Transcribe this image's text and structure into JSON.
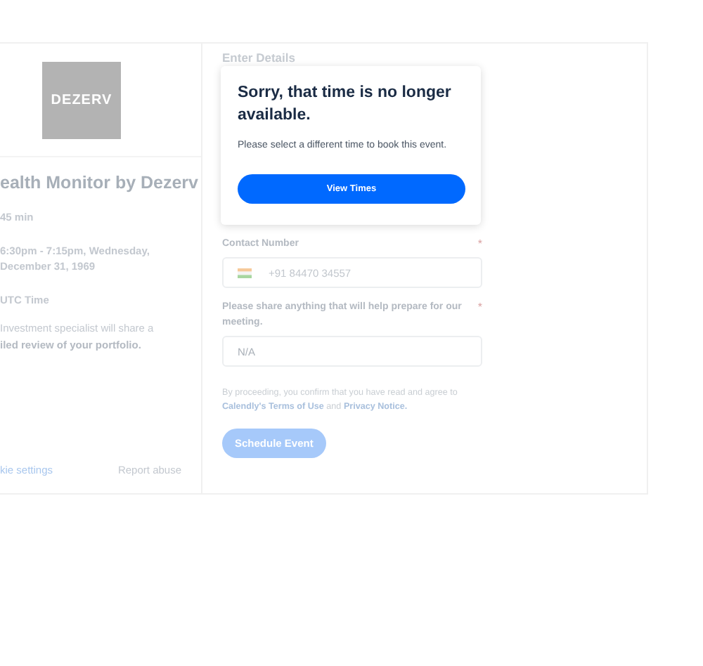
{
  "event": {
    "logo": "DEZERV",
    "title": "ealth Monitor by Dezerv",
    "details": [
      {
        "kind": "plain",
        "text": "45 min"
      },
      {
        "kind": "plain",
        "text": "6:30pm - 7:15pm, Wednesday, December 31, 1969"
      },
      {
        "kind": "plain",
        "text": "UTC Time"
      },
      {
        "kind": "rich",
        "text": "Investment specialist will share a **iled review of your portfolio.**"
      }
    ],
    "footer": [
      "kie settings",
      "Report abuse"
    ]
  },
  "form": {
    "heading": "Enter Details",
    "fields": [
      {
        "label": "Contact Number",
        "required_mark": "*",
        "kind": "phone",
        "value": "+91 84470 34557"
      },
      {
        "label": "Please share anything that will help prepare for our meeting.",
        "required_mark": "*",
        "kind": "text",
        "placeholder": "N/A"
      }
    ],
    "legal": {
      "text": "By proceeding, you confirm that you have read and agree to",
      "link1": "Calendly's Terms of Use",
      "joiner": "and",
      "link2": "Privacy Notice."
    },
    "submit": {
      "label": "Schedule Event",
      "disabled": true
    }
  },
  "dialog": {
    "title": "Sorry, that time is no longer available.",
    "message": "Please select a different time to book this event.",
    "button": "View Times"
  }
}
